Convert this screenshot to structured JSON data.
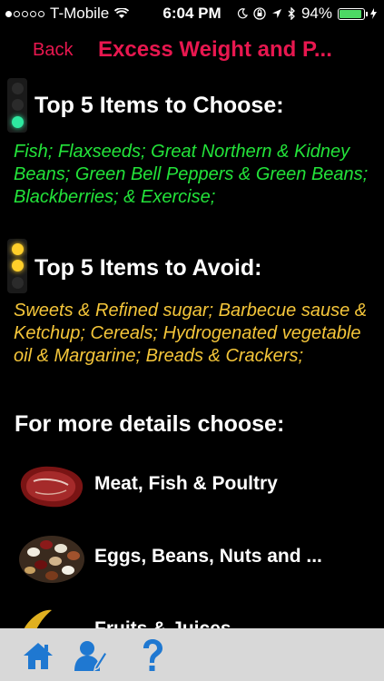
{
  "status_bar": {
    "carrier": "T-Mobile",
    "time": "6:04 PM",
    "battery": "94%",
    "signal_bars": 1,
    "battery_level": 0.94
  },
  "nav": {
    "back_label": "Back",
    "title": "Excess Weight and P..."
  },
  "choose": {
    "title": "Top 5 Items to Choose:",
    "text": "Fish; Flaxseeds; Great Northern & Kidney Beans; Green Bell Peppers & Green Beans; Blackberries;  & Exercise;",
    "color": "#23e33a"
  },
  "avoid": {
    "title": "Top 5 Items to Avoid:",
    "text": "Sweets & Refined sugar; Barbecue sause & Ketchup; Cereals; Hydrogenated vegetable oil & Margarine; Breads & Crackers;",
    "color": "#f5c63a"
  },
  "details": {
    "title": "For more details choose:",
    "items": [
      {
        "label": "Meat, Fish & Poultry",
        "icon": "steak-icon"
      },
      {
        "label": "Eggs, Beans, Nuts and ...",
        "icon": "beans-icon"
      },
      {
        "label": "Fruits & Juices",
        "icon": "banana-icon"
      }
    ]
  },
  "tab_bar": {
    "items": [
      {
        "icon": "home-icon"
      },
      {
        "icon": "user-edit-icon"
      },
      {
        "icon": "question-icon"
      }
    ]
  },
  "colors": {
    "accent": "#e8174f",
    "tab_icon": "#1f78d1"
  }
}
